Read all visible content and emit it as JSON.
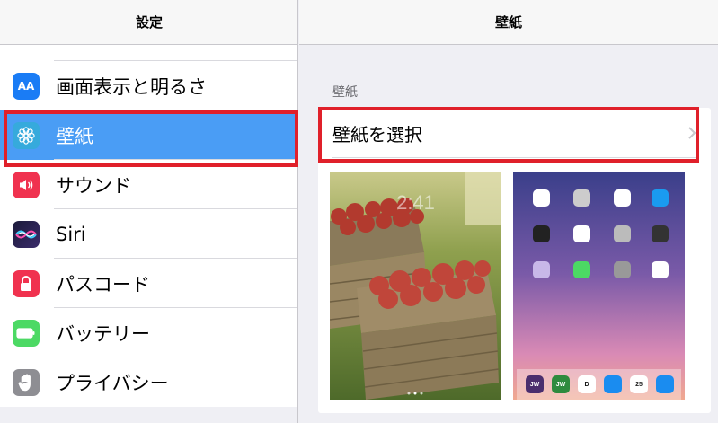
{
  "left_pane": {
    "title": "設定",
    "items": [
      {
        "label": "画面表示と明るさ",
        "icon": "display-brightness-icon",
        "icon_text": "AA",
        "color": "#1a7cf5"
      },
      {
        "label": "壁紙",
        "icon": "wallpaper-flower-icon",
        "color": "#36aadc",
        "selected": true
      },
      {
        "label": "サウンド",
        "icon": "speaker-icon",
        "color": "#f0324f"
      },
      {
        "label": "Siri",
        "icon": "siri-icon",
        "color": "#2a2d6a"
      },
      {
        "label": "パスコード",
        "icon": "lock-icon",
        "color": "#f0324f"
      },
      {
        "label": "バッテリー",
        "icon": "battery-icon",
        "color": "#4cd964"
      },
      {
        "label": "プライバシー",
        "icon": "hand-icon",
        "color": "#8e8e93"
      }
    ]
  },
  "right_pane": {
    "title": "壁紙",
    "section_label": "壁紙",
    "choose_label": "壁紙を選択",
    "lock_screen_preview": {
      "time": "2:41"
    },
    "home_screen_preview": {
      "dock_apps": [
        {
          "text": "JW",
          "color": "#4a2e6e"
        },
        {
          "text": "JW",
          "color": "#2e8b3e"
        },
        {
          "text": "D",
          "color": "#ffffff"
        },
        {
          "text": "",
          "color": "#1a8cf0"
        },
        {
          "text": "25",
          "color": "#ffffff"
        },
        {
          "text": "",
          "color": "#1a8cf0"
        }
      ]
    }
  },
  "colors": {
    "selection_blue": "#4a9df5",
    "highlight_red": "#e0202a"
  }
}
